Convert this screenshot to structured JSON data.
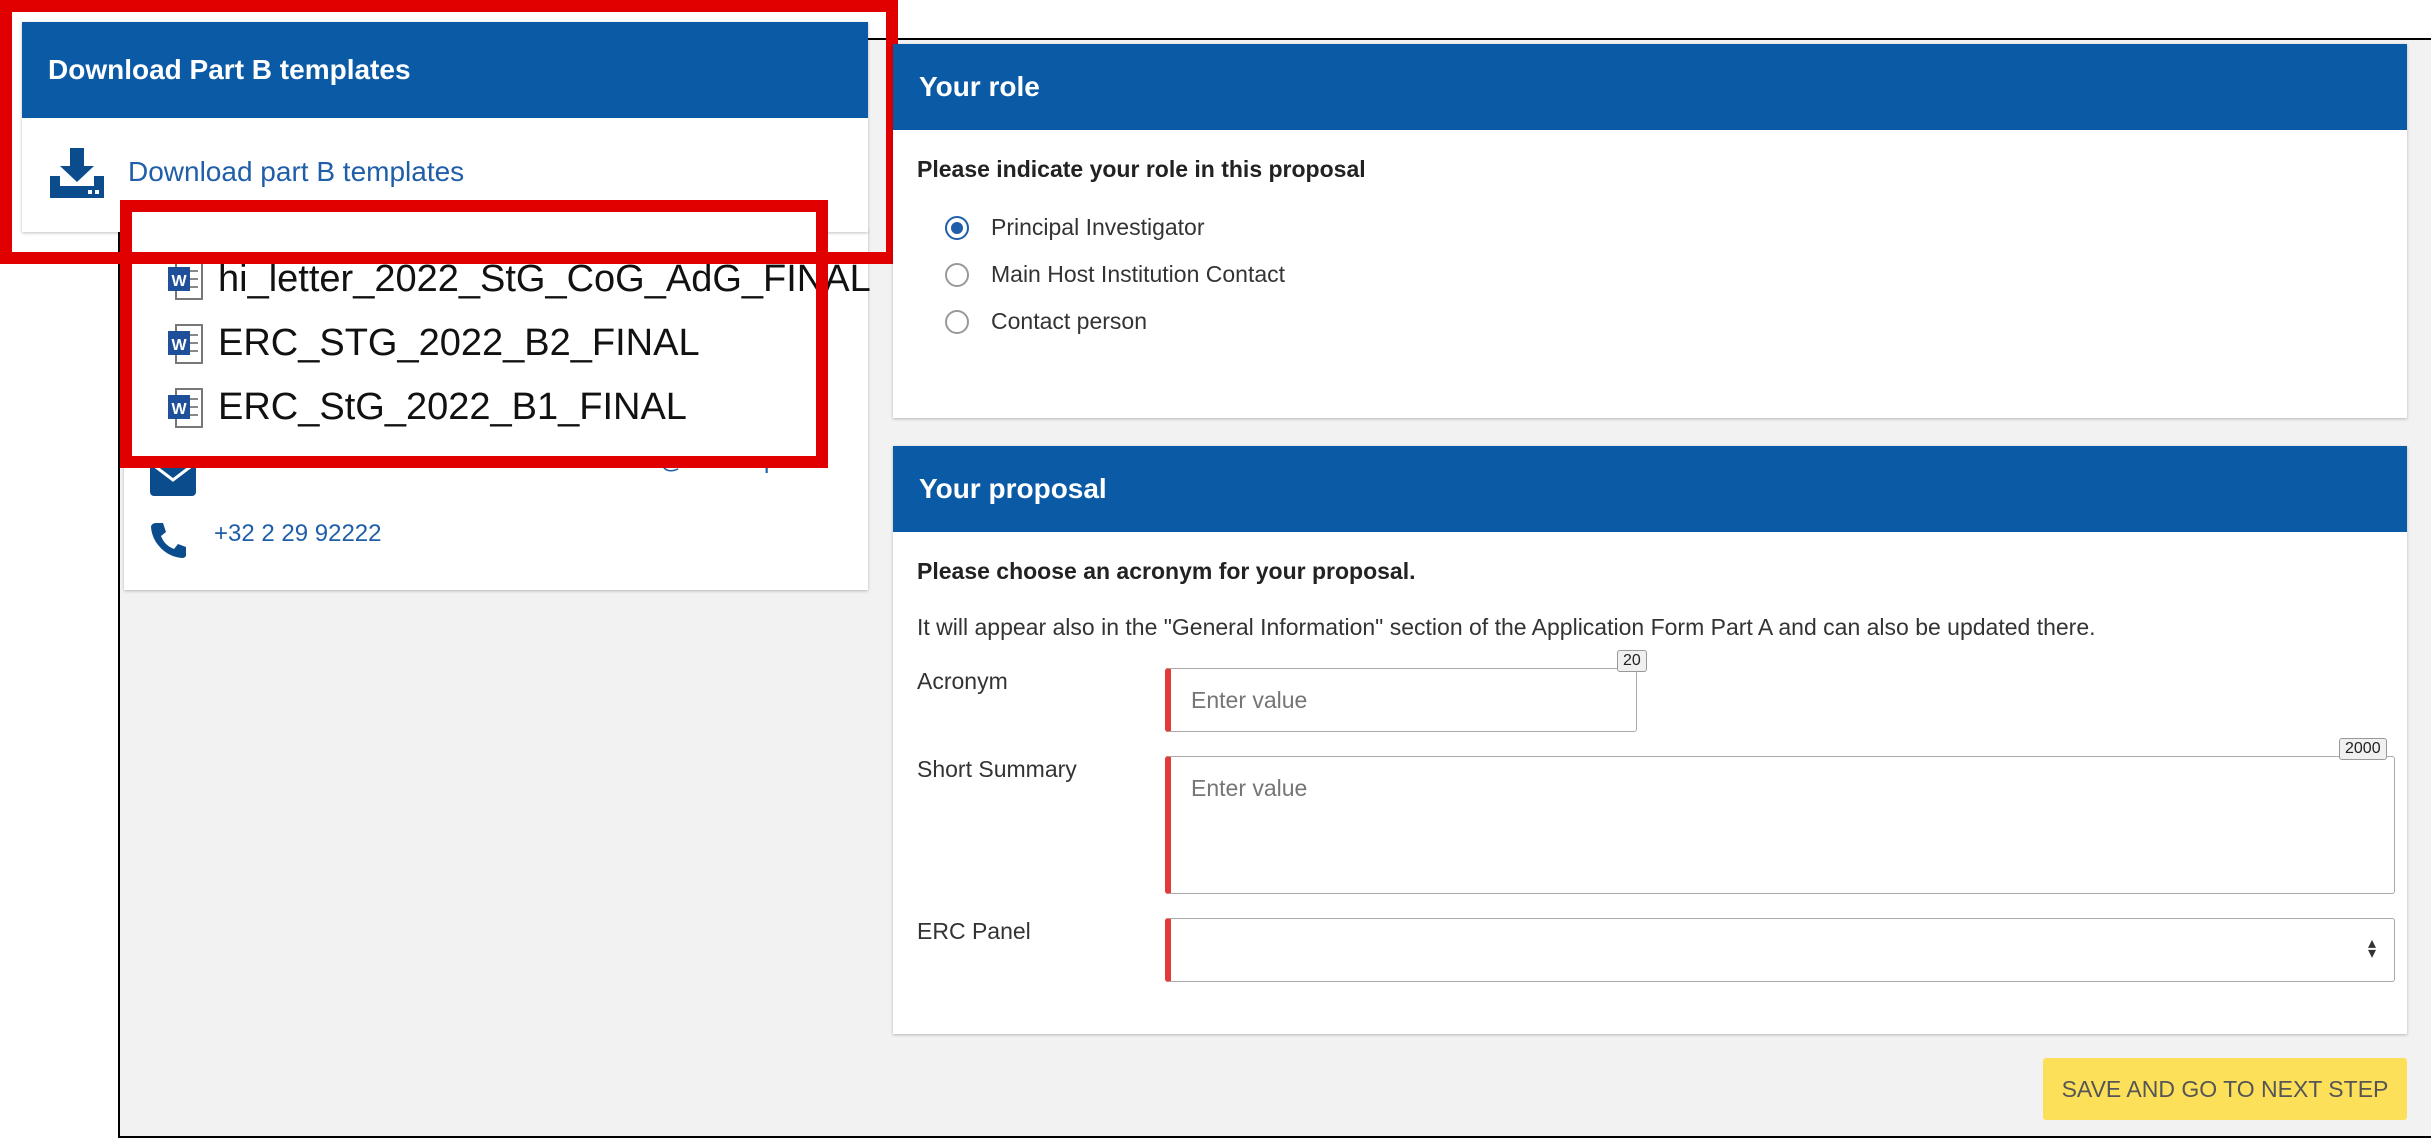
{
  "download_card": {
    "title": "Download Part B templates",
    "link_label": "Download part B templates"
  },
  "files": [
    {
      "name": "hi_letter_2022_StG_CoG_AdG_FINAL"
    },
    {
      "name": "ERC_STG_2022_B2_FINAL"
    },
    {
      "name": "ERC_StG_2022_B1_FINAL"
    }
  ],
  "contact": {
    "email": "EC-FUNDING-TENDER-SERVICE-DESK@ec.europa.eu",
    "phone": "+32 2 29 92222"
  },
  "role": {
    "title": "Your role",
    "question": "Please indicate your role in this proposal",
    "options": [
      {
        "label": "Principal Investigator",
        "selected": true
      },
      {
        "label": "Main Host Institution Contact",
        "selected": false
      },
      {
        "label": "Contact person",
        "selected": false
      }
    ]
  },
  "proposal": {
    "title": "Your proposal",
    "question": "Please choose an acronym for your proposal.",
    "note": "It will appear also in the \"General Information\" section of the Application Form Part A and can also be updated there.",
    "acronym": {
      "label": "Acronym",
      "placeholder": "Enter value",
      "max": "20"
    },
    "summary": {
      "label": "Short Summary",
      "placeholder": "Enter value",
      "max": "2000"
    },
    "panel": {
      "label": "ERC Panel",
      "value": ""
    }
  },
  "actions": {
    "next_label": "SAVE AND GO TO NEXT STEP"
  },
  "colors": {
    "header_blue": "#0b5aa6",
    "link_blue": "#1f5ea8",
    "highlight_red": "#e00000",
    "required_red": "#e03a3a",
    "button_yellow": "#fde05a"
  }
}
